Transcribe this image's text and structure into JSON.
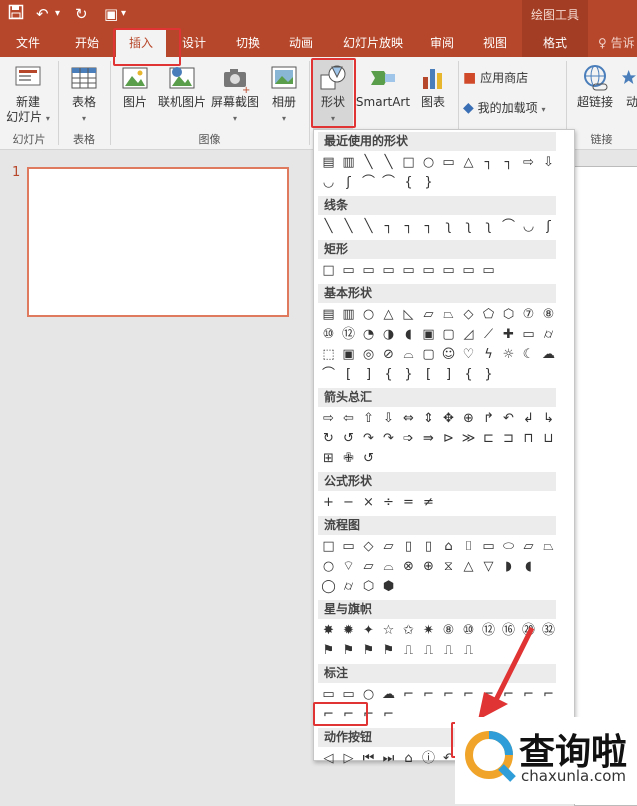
{
  "quick_access": {
    "save_icon": "save-icon",
    "undo_glyph": "↶",
    "redo_glyph": "↻",
    "present_glyph": "▣",
    "more_glyph": "▾"
  },
  "context_group": "绘图工具",
  "tabs": [
    {
      "label": "文件",
      "active": false
    },
    {
      "label": "开始",
      "active": false
    },
    {
      "label": "插入",
      "active": true
    },
    {
      "label": "设计",
      "active": false
    },
    {
      "label": "切换",
      "active": false
    },
    {
      "label": "动画",
      "active": false
    },
    {
      "label": "幻灯片放映",
      "active": false
    },
    {
      "label": "审阅",
      "active": false
    },
    {
      "label": "视图",
      "active": false
    },
    {
      "label": "格式",
      "active": false
    }
  ],
  "tell_me": "♀ 告诉",
  "ribbon": {
    "new_slide": {
      "line1": "新建",
      "line2": "幻灯片"
    },
    "table": "表格",
    "picture": "图片",
    "online_picture": "联机图片",
    "screenshot": "屏幕截图",
    "album": "相册",
    "shapes": "形状",
    "smartart": "SmartArt",
    "chart": "图表",
    "store": "应用商店",
    "my_addins": "我的加载项",
    "hyperlink": "超链接",
    "action": "动",
    "groups": {
      "slides": "幻灯片",
      "tables": "表格",
      "images": "图像",
      "links": "链接"
    }
  },
  "slide_panel": {
    "slide_number": "1"
  },
  "shapes_gallery": {
    "sections": [
      {
        "title": "最近使用的形状",
        "rows": [
          [
            "▤",
            "▥",
            "╲",
            "╲",
            "□",
            "○",
            "▭",
            "△",
            "┐",
            "┐",
            "⇨",
            "⇩"
          ],
          [
            "◡",
            "ʃ",
            "⌒",
            "⌒",
            "{",
            "}"
          ]
        ]
      },
      {
        "title": "线条",
        "rows": [
          [
            "╲",
            "╲",
            "╲",
            "┐",
            "┐",
            "┐",
            "ʅ",
            "ʅ",
            "ʅ",
            "⌒",
            "◡",
            "ʃ"
          ]
        ]
      },
      {
        "title": "矩形",
        "rows": [
          [
            "□",
            "▭",
            "▭",
            "▭",
            "▭",
            "▭",
            "▭",
            "▭",
            "▭"
          ]
        ]
      },
      {
        "title": "基本形状",
        "rows": [
          [
            "▤",
            "▥",
            "○",
            "△",
            "◺",
            "▱",
            "⏢",
            "◇",
            "⬠",
            "⬡",
            "⑦",
            "⑧"
          ],
          [
            "⑩",
            "⑫",
            "◔",
            "◑",
            "◖",
            "▣",
            "▢",
            "◿",
            "⟋",
            "✚",
            "▭",
            "⌭"
          ],
          [
            "⬚",
            "▣",
            "◎",
            "⊘",
            "⌓",
            "▢",
            "☺",
            "♡",
            "ϟ",
            "☼",
            "☾",
            "☁"
          ],
          [
            "⌒",
            "[",
            "]",
            "{",
            "}",
            "[",
            "]",
            "{",
            "}"
          ]
        ]
      },
      {
        "title": "箭头总汇",
        "rows": [
          [
            "⇨",
            "⇦",
            "⇧",
            "⇩",
            "⇔",
            "⇕",
            "✥",
            "⊕",
            "↱",
            "↶",
            "↲",
            "↳"
          ],
          [
            "↻",
            "↺",
            "↷",
            "↷",
            "➩",
            "⇛",
            "⊳",
            "≫",
            "⊏",
            "⊐",
            "⊓",
            "⊔"
          ],
          [
            "⊞",
            "✙",
            "↺"
          ]
        ]
      },
      {
        "title": "公式形状",
        "rows": [
          [
            "+",
            "−",
            "×",
            "÷",
            "=",
            "≠"
          ]
        ]
      },
      {
        "title": "流程图",
        "rows": [
          [
            "□",
            "▭",
            "◇",
            "▱",
            "▯",
            "▯",
            "⌂",
            "⌷",
            "▭",
            "⬭",
            "⏥",
            "⏢"
          ],
          [
            "○",
            "⌔",
            "▱",
            "⌓",
            "⊗",
            "⊕",
            "⧖",
            "△",
            "▽",
            "◗",
            "◖"
          ],
          [
            "◯",
            "⌭",
            "⬡",
            "⬢"
          ]
        ]
      },
      {
        "title": "星与旗帜",
        "rows": [
          [
            "✸",
            "✹",
            "✦",
            "☆",
            "✩",
            "✷",
            "⑧",
            "⑩",
            "⑫",
            "⑯",
            "⑳",
            "㉜"
          ],
          [
            "⚑",
            "⚑",
            "⚑",
            "⚑",
            "⎍",
            "⎍",
            "⎍",
            "⎍"
          ]
        ]
      },
      {
        "title": "标注",
        "rows": [
          [
            "▭",
            "▭",
            "○",
            "☁",
            "⌐",
            "⌐",
            "⌐",
            "⌐",
            "⌐",
            "⌐",
            "⌐",
            "⌐"
          ],
          [
            "⌐",
            "⌐",
            "⌐",
            "⌐"
          ]
        ]
      },
      {
        "title": "动作按钮",
        "rows": [
          [
            "◁",
            "▷",
            "⏮",
            "⏭",
            "⌂",
            "ⓘ",
            "↶"
          ]
        ]
      }
    ]
  },
  "watermark": {
    "logo_glyph": "Q",
    "title": "查询啦",
    "url": "chaxunla.com"
  },
  "colors": {
    "brand": "#b7472a",
    "highlight": "#e03333"
  }
}
